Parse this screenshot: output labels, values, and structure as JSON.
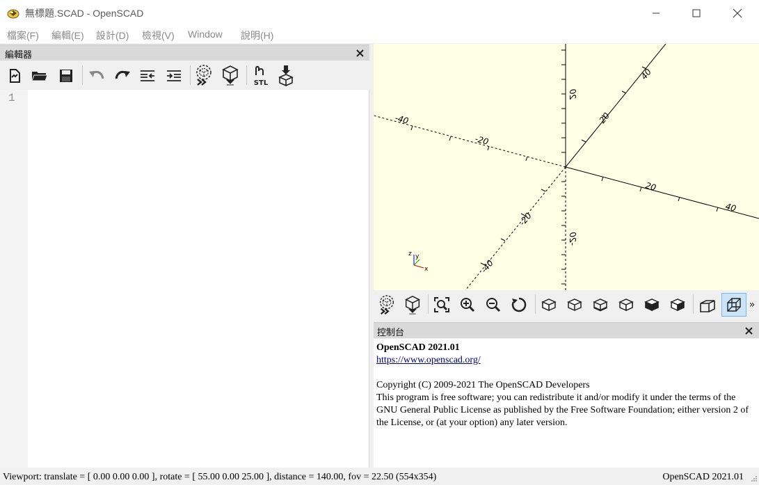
{
  "window": {
    "title": "無標題.SCAD - OpenSCAD"
  },
  "menu": [
    "檔案(F)",
    "編輯(E)",
    "設計(D)",
    "檢視(V)",
    "Window",
    "說明(H)"
  ],
  "editor": {
    "title": "編輯器",
    "line_numbers": [
      "1"
    ],
    "toolbar": {
      "icons": [
        "new-file-icon",
        "open-file-icon",
        "save-icon",
        "undo-icon",
        "redo-icon",
        "unindent-icon",
        "indent-icon",
        "preview-icon",
        "render-icon",
        "export-stl-icon",
        "send-to-3d-print-icon"
      ],
      "stl_label": "STL"
    }
  },
  "viewport": {
    "axis_labels": [
      "-40",
      "-20",
      "20",
      "40",
      "20",
      "-20",
      "20",
      "-20",
      "40",
      "-40",
      "20",
      "40"
    ],
    "axis_indicator": {
      "x": "x",
      "y": "y",
      "z": "z"
    },
    "colors": {
      "background": "#ffffe5",
      "axes": "#000000"
    }
  },
  "view_toolbar": {
    "icons": [
      "preview-icon",
      "render-icon",
      "view-all-icon",
      "zoom-in-icon",
      "zoom-out-icon",
      "reset-view-icon",
      "view-right-icon",
      "view-top-icon",
      "view-bottom-icon",
      "view-left-icon",
      "view-front-icon",
      "view-back-icon",
      "perspective-icon",
      "orthogonal-icon",
      "more-icon"
    ],
    "more_label": "»"
  },
  "console": {
    "title": "控制台",
    "version": "OpenSCAD 2021.01",
    "link": "https://www.openscad.org/",
    "copyright": "Copyright (C) 2009-2021 The OpenSCAD Developers",
    "license": "This program is free software; you can redistribute it and/or modify it under the terms of the GNU General Public License as published by the Free Software Foundation; either version 2 of the License, or (at your option) any later version."
  },
  "statusbar": {
    "viewport": "Viewport: translate = [ 0.00 0.00 0.00 ], rotate = [ 55.00 0.00 25.00 ], distance = 140.00, fov = 22.50 (554x354)",
    "version": "OpenSCAD 2021.01"
  }
}
